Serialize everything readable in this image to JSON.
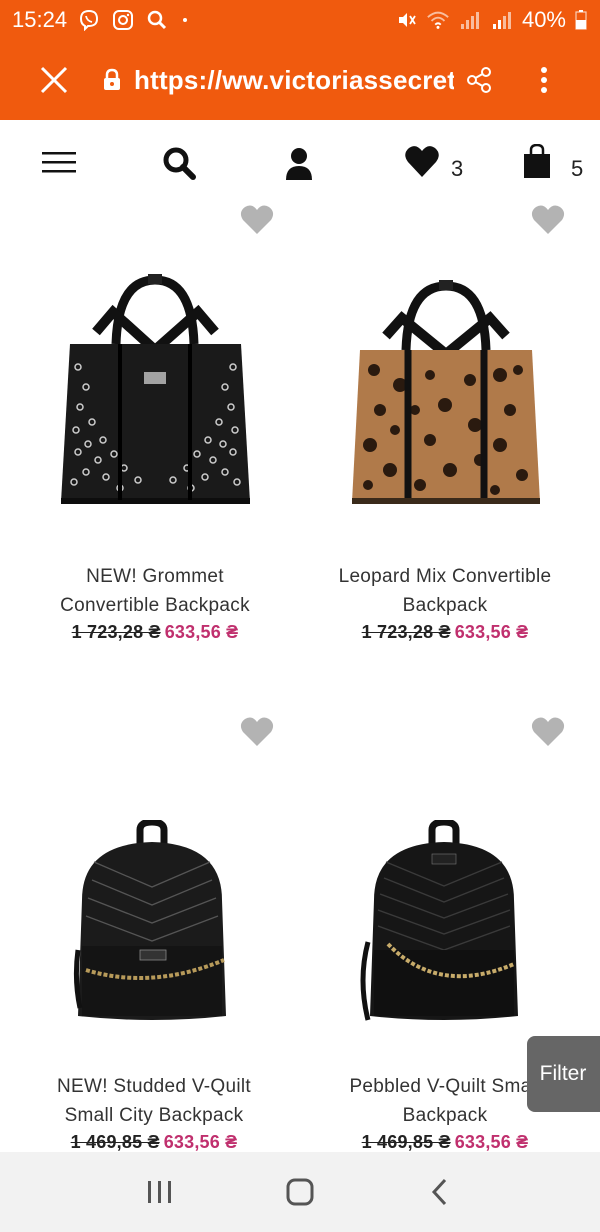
{
  "status_bar": {
    "time": "15:24",
    "battery": "40%",
    "icons": [
      "viber-icon",
      "instagram-icon",
      "search-icon",
      "mute-icon",
      "wifi-icon",
      "signal-icon",
      "signal-icon",
      "battery-icon"
    ]
  },
  "browser": {
    "url": "https://ww.victoriassecret....",
    "icons": [
      "close-icon",
      "lock-icon",
      "share-icon",
      "more-icon"
    ]
  },
  "header": {
    "wishlist_count": "3",
    "bag_count": "5",
    "icons": [
      "menu-icon",
      "search-icon",
      "account-icon",
      "heart-icon",
      "bag-icon"
    ]
  },
  "products": [
    {
      "name_line1": "NEW! Grommet",
      "name_line2": "Convertible Backpack",
      "old_price": "1 723,28 ₴",
      "new_price": "633,56 ₴"
    },
    {
      "name_line1": "Leopard Mix Convertible",
      "name_line2": "Backpack",
      "old_price": "1 723,28 ₴",
      "new_price": "633,56 ₴"
    },
    {
      "name_line1": "NEW! Studded V-Quilt",
      "name_line2": "Small City Backpack",
      "old_price": "1 469,85 ₴",
      "new_price": "633,56 ₴"
    },
    {
      "name_line1": "Pebbled V-Quilt Small",
      "name_line2": "Backpack",
      "old_price": "1 469,85 ₴",
      "new_price": "633,56 ₴"
    }
  ],
  "filter_label": "Filter",
  "colors": {
    "brand_bar": "#f05a0e",
    "sale_price": "#c0306e",
    "heart_gray": "#b3b3b3"
  }
}
